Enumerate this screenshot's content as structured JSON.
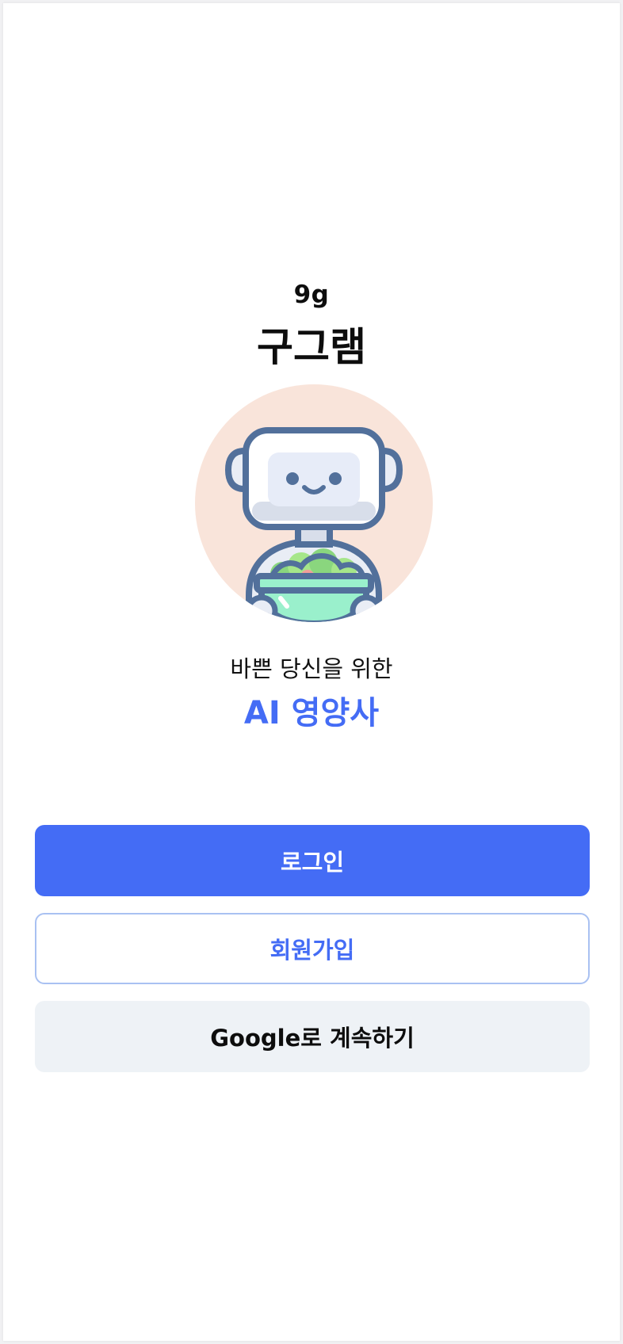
{
  "app": {
    "logo_text": "9g",
    "name": "구그램"
  },
  "mascot": {
    "icon": "robot-with-salad-bowl-icon",
    "background_color": "#f9e4da"
  },
  "hero": {
    "tagline": "바쁜 당신을 위한",
    "highlight": "AI 영양사"
  },
  "actions": {
    "login_label": "로그인",
    "signup_label": "회원가입",
    "google_label": "Google로 계속하기"
  },
  "colors": {
    "accent": "#446cf5",
    "signup_border": "#a9c1f2",
    "google_bg": "#eef2f6",
    "text": "#0d0d0d"
  }
}
